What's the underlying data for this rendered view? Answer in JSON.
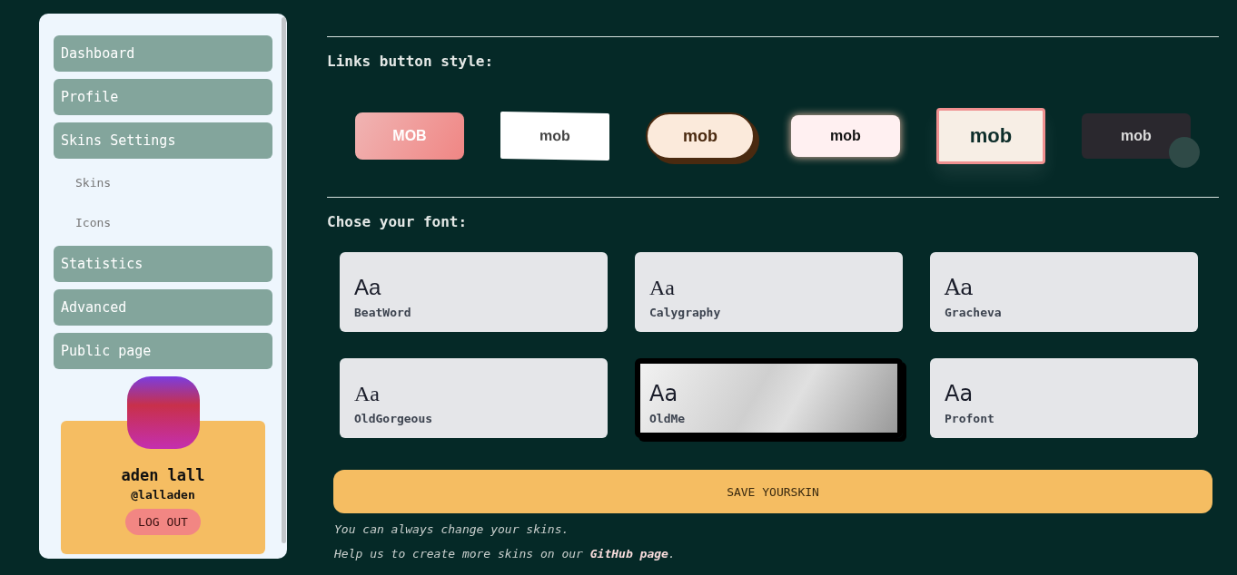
{
  "sidebar": {
    "items": [
      {
        "label": "Dashboard",
        "kind": "main"
      },
      {
        "label": "Profile",
        "kind": "main"
      },
      {
        "label": "Skins Settings",
        "kind": "main"
      },
      {
        "label": "Skins",
        "kind": "sub"
      },
      {
        "label": "Icons",
        "kind": "sub"
      },
      {
        "label": "Statistics",
        "kind": "main"
      },
      {
        "label": "Advanced",
        "kind": "main"
      },
      {
        "label": "Public page",
        "kind": "main"
      }
    ],
    "profile": {
      "name": "aden lall",
      "handle": "@lalladen",
      "logout": "LOG OUT"
    }
  },
  "links_section": {
    "title": "Links button style:",
    "styles": [
      {
        "label": "MOB",
        "kind": "gradient"
      },
      {
        "label": "mob",
        "kind": "paper"
      },
      {
        "label": "mob",
        "kind": "pill"
      },
      {
        "label": "mob",
        "kind": "glow"
      },
      {
        "label": "mob",
        "kind": "framed"
      },
      {
        "label": "mob",
        "kind": "dark"
      }
    ]
  },
  "font_section": {
    "title": "Chose your font:",
    "fonts": [
      {
        "sample": "Aa",
        "name": "BeatWord",
        "selected": false
      },
      {
        "sample": "Aa",
        "name": "Calygraphy",
        "selected": false
      },
      {
        "sample": "Aa",
        "name": "Gracheva",
        "selected": false
      },
      {
        "sample": "Aa",
        "name": "OldGorgeous",
        "selected": false
      },
      {
        "sample": "Aa",
        "name": "OldMe",
        "selected": true
      },
      {
        "sample": "Aa",
        "name": "Profont",
        "selected": false
      }
    ]
  },
  "save_button": "SAVE YOURSKIN",
  "notes": {
    "line": "You can always change your skins.",
    "help_before": "Help us to create more skins on our ",
    "help_link": "GitHub page",
    "help_after": "."
  }
}
